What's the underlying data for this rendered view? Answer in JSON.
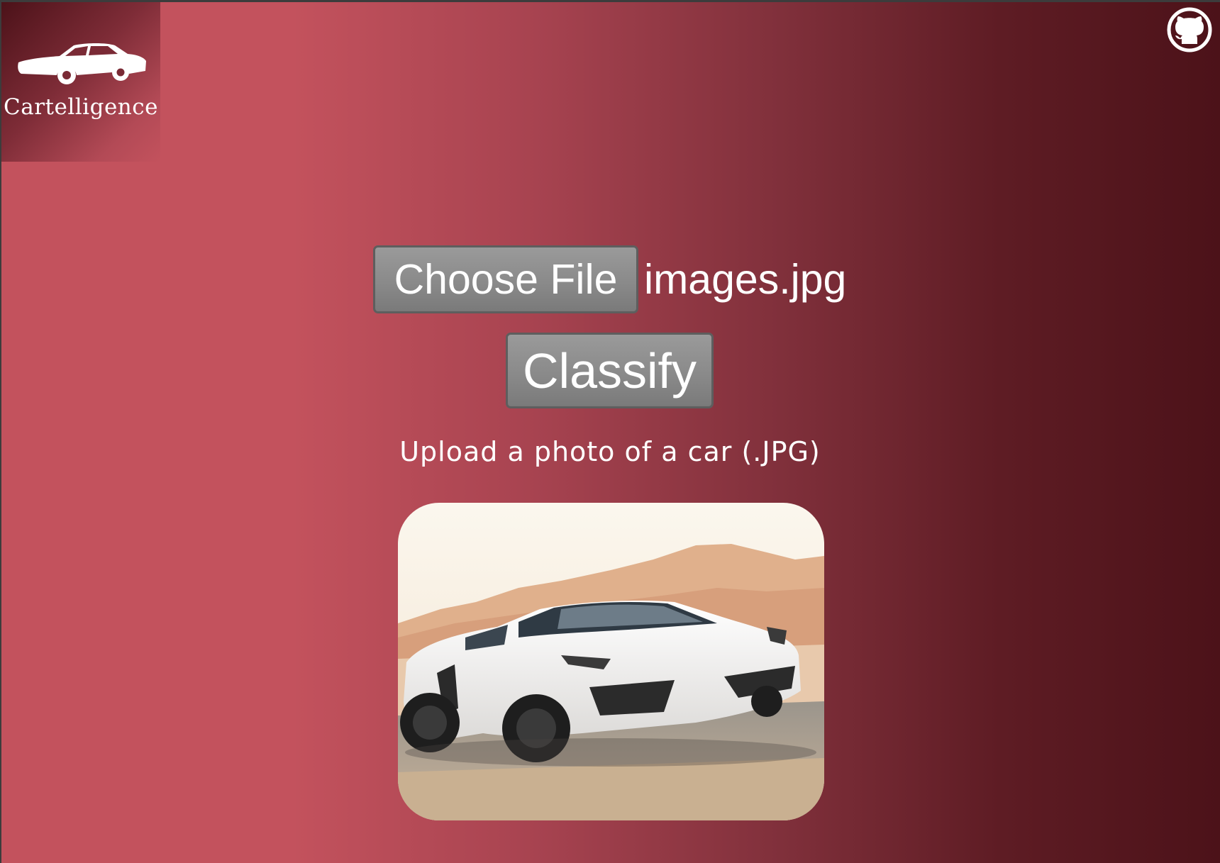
{
  "brand": {
    "name": "Cartelligence",
    "logo_icon": "car-silhouette-icon"
  },
  "header": {
    "github_icon": "github-icon"
  },
  "upload": {
    "choose_button_label": "Choose File",
    "selected_file": "images.jpg",
    "classify_button_label": "Classify",
    "hint": "Upload a photo of a car (.JPG)"
  },
  "preview": {
    "image_subject": "white-sports-car-photo"
  },
  "colors": {
    "background_left": "#c3525d",
    "background_right": "#4c1219",
    "button_gray": "#8a8a8a",
    "text": "#ffffff"
  }
}
